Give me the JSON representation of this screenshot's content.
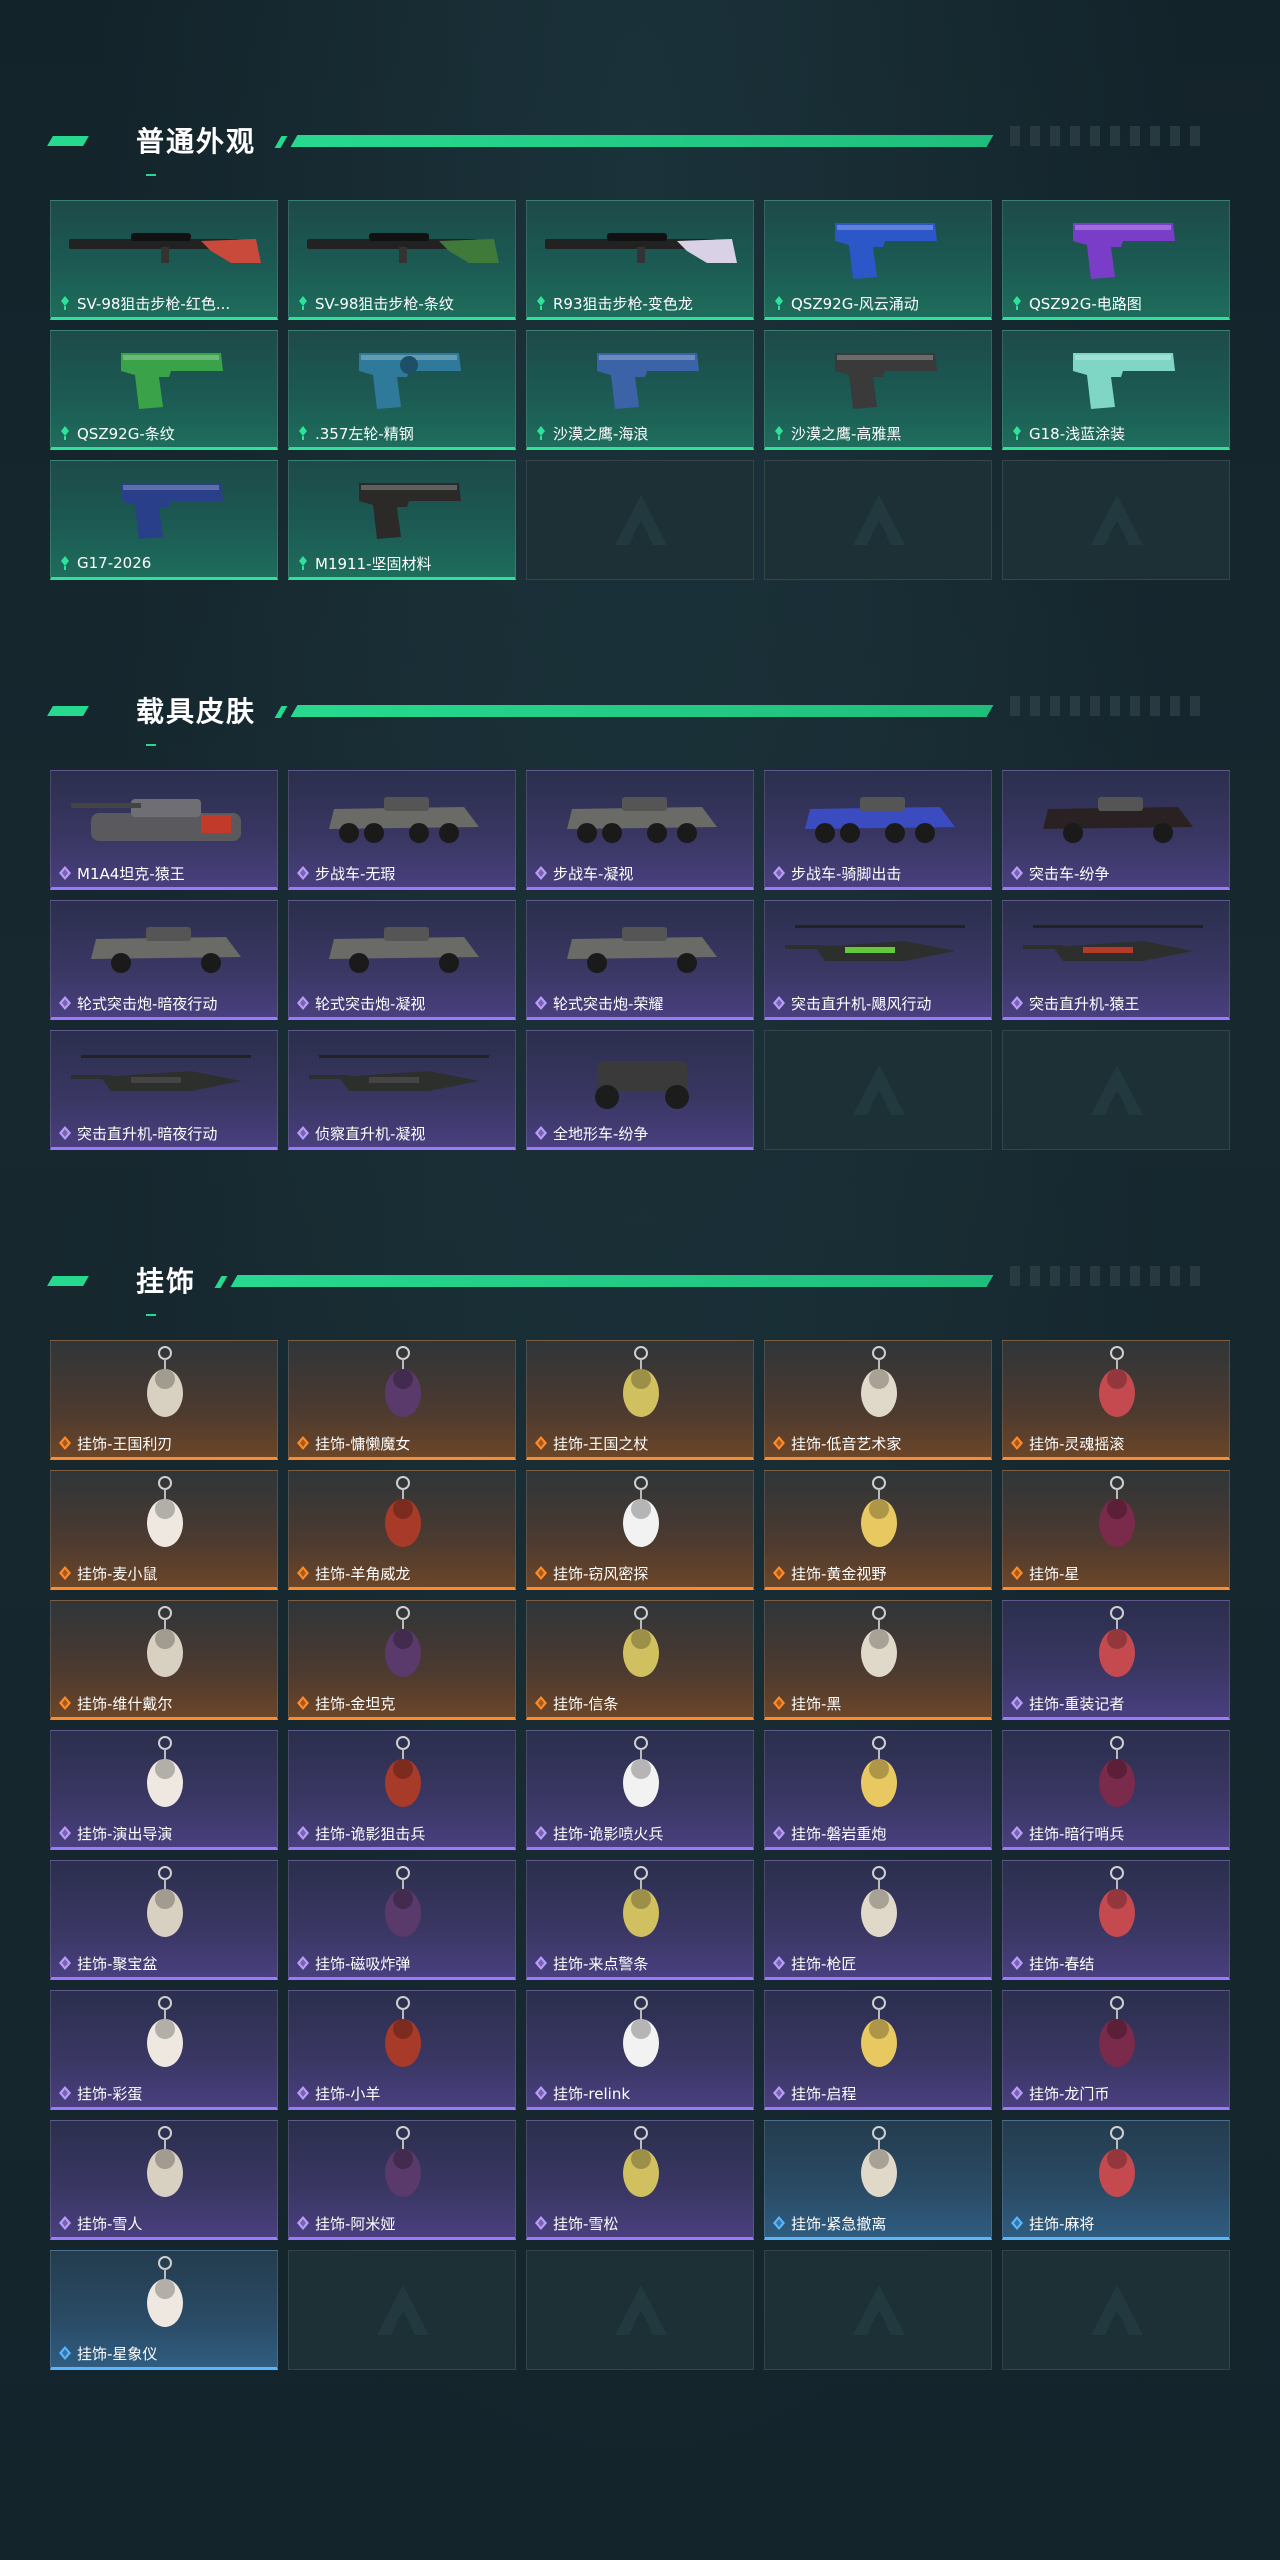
{
  "colors": {
    "accent": "#27d98f",
    "green_rarity": "#2fe29b",
    "purple_rarity": "#9b79ff",
    "orange_rarity": "#ff8a2a",
    "blue_rarity": "#58b6ff"
  },
  "sections": [
    {
      "title": "普通外观",
      "items": [
        {
          "label": "SV-98狙击步枪-红色...",
          "rarity": "green",
          "icon": "sniper-rifle-icon"
        },
        {
          "label": "SV-98狙击步枪-条纹",
          "rarity": "green",
          "icon": "sniper-rifle-icon"
        },
        {
          "label": "R93狙击步枪-变色龙",
          "rarity": "green",
          "icon": "sniper-rifle-icon"
        },
        {
          "label": "QSZ92G-风云涌动",
          "rarity": "green",
          "icon": "pistol-icon"
        },
        {
          "label": "QSZ92G-电路图",
          "rarity": "green",
          "icon": "pistol-icon"
        },
        {
          "label": "QSZ92G-条纹",
          "rarity": "green",
          "icon": "pistol-icon"
        },
        {
          "label": ".357左轮-精钢",
          "rarity": "green",
          "icon": "revolver-icon"
        },
        {
          "label": "沙漠之鹰-海浪",
          "rarity": "green",
          "icon": "pistol-icon"
        },
        {
          "label": "沙漠之鹰-高雅黑",
          "rarity": "green",
          "icon": "pistol-icon"
        },
        {
          "label": "G18-浅蓝涂装",
          "rarity": "green",
          "icon": "pistol-icon"
        },
        {
          "label": "G17-2026",
          "rarity": "green",
          "icon": "pistol-icon"
        },
        {
          "label": "M1911-坚固材料",
          "rarity": "green",
          "icon": "pistol-icon"
        },
        {
          "label": "",
          "rarity": "empty",
          "icon": "empty-slot-logo-icon"
        },
        {
          "label": "",
          "rarity": "empty",
          "icon": "empty-slot-logo-icon"
        },
        {
          "label": "",
          "rarity": "empty",
          "icon": "empty-slot-logo-icon"
        }
      ]
    },
    {
      "title": "载具皮肤",
      "items": [
        {
          "label": "M1A4坦克-猿王",
          "rarity": "purple",
          "icon": "tank-icon"
        },
        {
          "label": "步战车-无瑕",
          "rarity": "purple",
          "icon": "armored-vehicle-icon"
        },
        {
          "label": "步战车-凝视",
          "rarity": "purple",
          "icon": "armored-vehicle-icon"
        },
        {
          "label": "步战车-骑脚出击",
          "rarity": "purple",
          "icon": "armored-vehicle-icon"
        },
        {
          "label": "突击车-纷争",
          "rarity": "purple",
          "icon": "assault-vehicle-icon"
        },
        {
          "label": "轮式突击炮-暗夜行动",
          "rarity": "purple",
          "icon": "armored-car-icon"
        },
        {
          "label": "轮式突击炮-凝视",
          "rarity": "purple",
          "icon": "armored-car-icon"
        },
        {
          "label": "轮式突击炮-荣耀",
          "rarity": "purple",
          "icon": "armored-car-icon"
        },
        {
          "label": "突击直升机-飓风行动",
          "rarity": "purple",
          "icon": "helicopter-icon"
        },
        {
          "label": "突击直升机-猿王",
          "rarity": "purple",
          "icon": "helicopter-icon"
        },
        {
          "label": "突击直升机-暗夜行动",
          "rarity": "purple",
          "icon": "helicopter-icon"
        },
        {
          "label": "侦察直升机-凝视",
          "rarity": "purple",
          "icon": "helicopter-icon"
        },
        {
          "label": "全地形车-纷争",
          "rarity": "purple",
          "icon": "atv-icon"
        },
        {
          "label": "",
          "rarity": "empty",
          "icon": "empty-slot-logo-icon"
        },
        {
          "label": "",
          "rarity": "empty",
          "icon": "empty-slot-logo-icon"
        }
      ]
    },
    {
      "title": "挂饰",
      "items": [
        {
          "label": "挂饰-王国利刃",
          "rarity": "orange",
          "icon": "charm-icon"
        },
        {
          "label": "挂饰-慵懒魔女",
          "rarity": "orange",
          "icon": "charm-icon"
        },
        {
          "label": "挂饰-王国之杖",
          "rarity": "orange",
          "icon": "charm-icon"
        },
        {
          "label": "挂饰-低音艺术家",
          "rarity": "orange",
          "icon": "charm-icon"
        },
        {
          "label": "挂饰-灵魂摇滚",
          "rarity": "orange",
          "icon": "charm-icon"
        },
        {
          "label": "挂饰-麦小鼠",
          "rarity": "orange",
          "icon": "charm-icon"
        },
        {
          "label": "挂饰-羊角威龙",
          "rarity": "orange",
          "icon": "charm-icon"
        },
        {
          "label": "挂饰-窃风密探",
          "rarity": "orange",
          "icon": "charm-icon"
        },
        {
          "label": "挂饰-黄金视野",
          "rarity": "orange",
          "icon": "charm-icon"
        },
        {
          "label": "挂饰-星",
          "rarity": "orange",
          "icon": "charm-icon"
        },
        {
          "label": "挂饰-维什戴尔",
          "rarity": "orange",
          "icon": "charm-icon"
        },
        {
          "label": "挂饰-金坦克",
          "rarity": "orange",
          "icon": "charm-icon"
        },
        {
          "label": "挂饰-信条",
          "rarity": "orange",
          "icon": "charm-icon"
        },
        {
          "label": "挂饰-黑",
          "rarity": "orange",
          "icon": "charm-icon"
        },
        {
          "label": "挂饰-重装记者",
          "rarity": "purple",
          "icon": "charm-icon"
        },
        {
          "label": "挂饰-演出导演",
          "rarity": "purple",
          "icon": "charm-icon"
        },
        {
          "label": "挂饰-诡影狙击兵",
          "rarity": "purple",
          "icon": "charm-icon"
        },
        {
          "label": "挂饰-诡影喷火兵",
          "rarity": "purple",
          "icon": "charm-icon"
        },
        {
          "label": "挂饰-磐岩重炮",
          "rarity": "purple",
          "icon": "charm-icon"
        },
        {
          "label": "挂饰-暗行哨兵",
          "rarity": "purple",
          "icon": "charm-icon"
        },
        {
          "label": "挂饰-聚宝盆",
          "rarity": "purple",
          "icon": "charm-icon"
        },
        {
          "label": "挂饰-磁吸炸弹",
          "rarity": "purple",
          "icon": "charm-icon"
        },
        {
          "label": "挂饰-来点警条",
          "rarity": "purple",
          "icon": "charm-icon"
        },
        {
          "label": "挂饰-枪匠",
          "rarity": "purple",
          "icon": "charm-icon"
        },
        {
          "label": "挂饰-春结",
          "rarity": "purple",
          "icon": "charm-icon"
        },
        {
          "label": "挂饰-彩蛋",
          "rarity": "purple",
          "icon": "charm-icon"
        },
        {
          "label": "挂饰-小羊",
          "rarity": "purple",
          "icon": "charm-icon"
        },
        {
          "label": "挂饰-relink",
          "rarity": "purple",
          "icon": "charm-icon"
        },
        {
          "label": "挂饰-启程",
          "rarity": "purple",
          "icon": "charm-icon"
        },
        {
          "label": "挂饰-龙门币",
          "rarity": "purple",
          "icon": "charm-icon"
        },
        {
          "label": "挂饰-雪人",
          "rarity": "purple",
          "icon": "charm-icon"
        },
        {
          "label": "挂饰-阿米娅",
          "rarity": "purple",
          "icon": "charm-icon"
        },
        {
          "label": "挂饰-雪松",
          "rarity": "purple",
          "icon": "charm-icon"
        },
        {
          "label": "挂饰-紧急撤离",
          "rarity": "blue",
          "icon": "charm-icon"
        },
        {
          "label": "挂饰-麻将",
          "rarity": "blue",
          "icon": "charm-icon"
        },
        {
          "label": "挂饰-星象仪",
          "rarity": "blue",
          "icon": "charm-icon"
        },
        {
          "label": "",
          "rarity": "empty",
          "icon": "empty-slot-logo-icon"
        },
        {
          "label": "",
          "rarity": "empty",
          "icon": "empty-slot-logo-icon"
        },
        {
          "label": "",
          "rarity": "empty",
          "icon": "empty-slot-logo-icon"
        },
        {
          "label": "",
          "rarity": "empty",
          "icon": "empty-slot-logo-icon"
        }
      ]
    }
  ]
}
